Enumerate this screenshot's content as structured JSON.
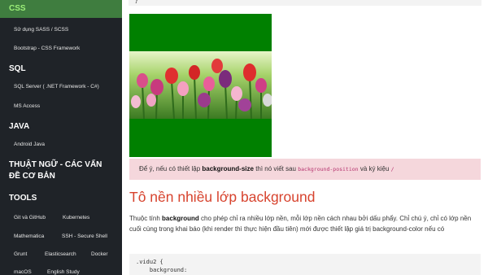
{
  "sidebar": {
    "sections": [
      {
        "title": "CSS",
        "items": [
          "Sử dụng SASS / SCSS",
          "Bootstrap - CSS Framework"
        ]
      },
      {
        "title": "SQL",
        "items": [
          "SQL Server ( .NET Framework - C#)",
          "MS Access"
        ]
      },
      {
        "title": "JAVA",
        "items": [
          "Android Java"
        ]
      },
      {
        "title": "THUẬT NGỮ - CÁC VẤN ĐỀ CƠ BẢN",
        "items": []
      },
      {
        "title": "TOOLS",
        "items": [
          "Git và GitHub",
          "Kubernetes",
          "Mathematica",
          "SSH - Secure Shell",
          "Grunt",
          "Elasticsearch",
          "Docker",
          "macOS",
          "English Study"
        ]
      }
    ]
  },
  "main": {
    "code_top": "}",
    "note": {
      "prefix": "Để ý, nếu có thiết lập ",
      "bold": "background-size",
      "middle": " thì nó viết sau ",
      "code": "background-position",
      "suffix": " và ký kiệu ",
      "code2": "/"
    },
    "heading": "Tô nền nhiều lớp background",
    "para": {
      "p1": "Thuộc tính ",
      "bold": "background",
      "p2": " cho phép chỉ ra nhiều lớp nền, mỗi lớp nền cách nhau bởi dấu phẩy. Chỉ chú ý, chỉ có lớp nền cuối cùng trong khai báo (khi render thì thực hiện đầu tiên) mới được thiết lập giá trị background-color nếu có"
    },
    "code_lines": [
      ".vidu2 {",
      "    background:"
    ]
  },
  "colors": {
    "sidebar_bg": "#1f2328",
    "active_bg": "#3f7d3f",
    "active_text": "#9df07a",
    "demo_green": "#008000",
    "note_bg": "#f5d7dc",
    "heading": "#d7432e"
  }
}
